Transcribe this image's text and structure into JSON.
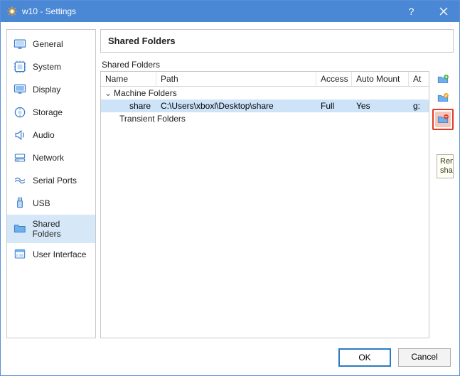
{
  "title": "w10 - Settings",
  "sidebar": {
    "items": [
      {
        "label": "General"
      },
      {
        "label": "System"
      },
      {
        "label": "Display"
      },
      {
        "label": "Storage"
      },
      {
        "label": "Audio"
      },
      {
        "label": "Network"
      },
      {
        "label": "Serial Ports"
      },
      {
        "label": "USB"
      },
      {
        "label": "Shared Folders"
      },
      {
        "label": "User Interface"
      }
    ]
  },
  "main": {
    "header": "Shared Folders",
    "sub_label": "Shared Folders",
    "columns": {
      "name": "Name",
      "path": "Path",
      "access": "Access",
      "mount": "Auto Mount",
      "at": "At"
    },
    "groups": {
      "machine": "Machine Folders",
      "transient": "Transient Folders"
    },
    "shares": [
      {
        "name": "share",
        "path": "C:\\Users\\xboxl\\Desktop\\share",
        "access": "Full",
        "mount": "Yes",
        "at": "g:"
      }
    ]
  },
  "tooltip": "Rem\nsha",
  "footer": {
    "ok": "OK",
    "cancel": "Cancel"
  }
}
